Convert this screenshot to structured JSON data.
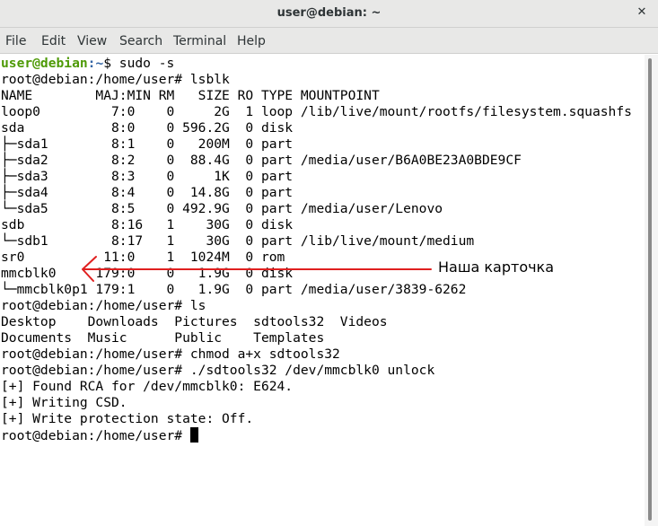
{
  "window": {
    "title": "user@debian: ~"
  },
  "menu": [
    "File",
    "Edit",
    "View",
    "Search",
    "Terminal",
    "Help"
  ],
  "terminal": {
    "first_prompt": {
      "user_host": "user@debian",
      "path": ":~",
      "command": "$ sudo -s"
    },
    "lines": [
      "root@debian:/home/user# lsblk",
      "NAME        MAJ:MIN RM   SIZE RO TYPE MOUNTPOINT",
      "loop0         7:0    0     2G  1 loop /lib/live/mount/rootfs/filesystem.squashfs",
      "sda           8:0    0 596.2G  0 disk",
      "├─sda1        8:1    0   200M  0 part",
      "├─sda2        8:2    0  88.4G  0 part /media/user/B6A0BE23A0BDE9CF",
      "├─sda3        8:3    0     1K  0 part",
      "├─sda4        8:4    0  14.8G  0 part",
      "└─sda5        8:5    0 492.9G  0 part /media/user/Lenovo",
      "sdb           8:16   1    30G  0 disk",
      "└─sdb1        8:17   1    30G  0 part /lib/live/mount/medium",
      "sr0          11:0    1  1024M  0 rom",
      "mmcblk0     179:0    0   1.9G  0 disk",
      "└─mmcblk0p1 179:1    0   1.9G  0 part /media/user/3839-6262",
      "root@debian:/home/user# ls",
      "Desktop    Downloads  Pictures  sdtools32  Videos",
      "Documents  Music      Public    Templates",
      "root@debian:/home/user# chmod a+x sdtools32",
      "root@debian:/home/user# ./sdtools32 /dev/mmcblk0 unlock",
      "[+] Found RCA for /dev/mmcblk0: E624.",
      "[+] Writing CSD.",
      "[+] Write protection state: Off."
    ],
    "current_prompt": "root@debian:/home/user# "
  },
  "annotation": {
    "text": "Наша карточка",
    "color": "#e02020"
  }
}
